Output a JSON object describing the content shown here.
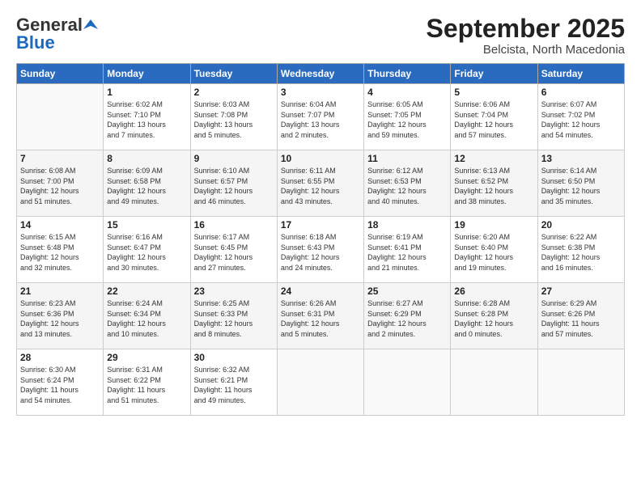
{
  "logo": {
    "general": "General",
    "blue": "Blue"
  },
  "title": "September 2025",
  "location": "Belcista, North Macedonia",
  "days_header": [
    "Sunday",
    "Monday",
    "Tuesday",
    "Wednesday",
    "Thursday",
    "Friday",
    "Saturday"
  ],
  "weeks": [
    [
      {
        "day": "",
        "info": ""
      },
      {
        "day": "1",
        "info": "Sunrise: 6:02 AM\nSunset: 7:10 PM\nDaylight: 13 hours\nand 7 minutes."
      },
      {
        "day": "2",
        "info": "Sunrise: 6:03 AM\nSunset: 7:08 PM\nDaylight: 13 hours\nand 5 minutes."
      },
      {
        "day": "3",
        "info": "Sunrise: 6:04 AM\nSunset: 7:07 PM\nDaylight: 13 hours\nand 2 minutes."
      },
      {
        "day": "4",
        "info": "Sunrise: 6:05 AM\nSunset: 7:05 PM\nDaylight: 12 hours\nand 59 minutes."
      },
      {
        "day": "5",
        "info": "Sunrise: 6:06 AM\nSunset: 7:04 PM\nDaylight: 12 hours\nand 57 minutes."
      },
      {
        "day": "6",
        "info": "Sunrise: 6:07 AM\nSunset: 7:02 PM\nDaylight: 12 hours\nand 54 minutes."
      }
    ],
    [
      {
        "day": "7",
        "info": "Sunrise: 6:08 AM\nSunset: 7:00 PM\nDaylight: 12 hours\nand 51 minutes."
      },
      {
        "day": "8",
        "info": "Sunrise: 6:09 AM\nSunset: 6:58 PM\nDaylight: 12 hours\nand 49 minutes."
      },
      {
        "day": "9",
        "info": "Sunrise: 6:10 AM\nSunset: 6:57 PM\nDaylight: 12 hours\nand 46 minutes."
      },
      {
        "day": "10",
        "info": "Sunrise: 6:11 AM\nSunset: 6:55 PM\nDaylight: 12 hours\nand 43 minutes."
      },
      {
        "day": "11",
        "info": "Sunrise: 6:12 AM\nSunset: 6:53 PM\nDaylight: 12 hours\nand 40 minutes."
      },
      {
        "day": "12",
        "info": "Sunrise: 6:13 AM\nSunset: 6:52 PM\nDaylight: 12 hours\nand 38 minutes."
      },
      {
        "day": "13",
        "info": "Sunrise: 6:14 AM\nSunset: 6:50 PM\nDaylight: 12 hours\nand 35 minutes."
      }
    ],
    [
      {
        "day": "14",
        "info": "Sunrise: 6:15 AM\nSunset: 6:48 PM\nDaylight: 12 hours\nand 32 minutes."
      },
      {
        "day": "15",
        "info": "Sunrise: 6:16 AM\nSunset: 6:47 PM\nDaylight: 12 hours\nand 30 minutes."
      },
      {
        "day": "16",
        "info": "Sunrise: 6:17 AM\nSunset: 6:45 PM\nDaylight: 12 hours\nand 27 minutes."
      },
      {
        "day": "17",
        "info": "Sunrise: 6:18 AM\nSunset: 6:43 PM\nDaylight: 12 hours\nand 24 minutes."
      },
      {
        "day": "18",
        "info": "Sunrise: 6:19 AM\nSunset: 6:41 PM\nDaylight: 12 hours\nand 21 minutes."
      },
      {
        "day": "19",
        "info": "Sunrise: 6:20 AM\nSunset: 6:40 PM\nDaylight: 12 hours\nand 19 minutes."
      },
      {
        "day": "20",
        "info": "Sunrise: 6:22 AM\nSunset: 6:38 PM\nDaylight: 12 hours\nand 16 minutes."
      }
    ],
    [
      {
        "day": "21",
        "info": "Sunrise: 6:23 AM\nSunset: 6:36 PM\nDaylight: 12 hours\nand 13 minutes."
      },
      {
        "day": "22",
        "info": "Sunrise: 6:24 AM\nSunset: 6:34 PM\nDaylight: 12 hours\nand 10 minutes."
      },
      {
        "day": "23",
        "info": "Sunrise: 6:25 AM\nSunset: 6:33 PM\nDaylight: 12 hours\nand 8 minutes."
      },
      {
        "day": "24",
        "info": "Sunrise: 6:26 AM\nSunset: 6:31 PM\nDaylight: 12 hours\nand 5 minutes."
      },
      {
        "day": "25",
        "info": "Sunrise: 6:27 AM\nSunset: 6:29 PM\nDaylight: 12 hours\nand 2 minutes."
      },
      {
        "day": "26",
        "info": "Sunrise: 6:28 AM\nSunset: 6:28 PM\nDaylight: 12 hours\nand 0 minutes."
      },
      {
        "day": "27",
        "info": "Sunrise: 6:29 AM\nSunset: 6:26 PM\nDaylight: 11 hours\nand 57 minutes."
      }
    ],
    [
      {
        "day": "28",
        "info": "Sunrise: 6:30 AM\nSunset: 6:24 PM\nDaylight: 11 hours\nand 54 minutes."
      },
      {
        "day": "29",
        "info": "Sunrise: 6:31 AM\nSunset: 6:22 PM\nDaylight: 11 hours\nand 51 minutes."
      },
      {
        "day": "30",
        "info": "Sunrise: 6:32 AM\nSunset: 6:21 PM\nDaylight: 11 hours\nand 49 minutes."
      },
      {
        "day": "",
        "info": ""
      },
      {
        "day": "",
        "info": ""
      },
      {
        "day": "",
        "info": ""
      },
      {
        "day": "",
        "info": ""
      }
    ]
  ]
}
